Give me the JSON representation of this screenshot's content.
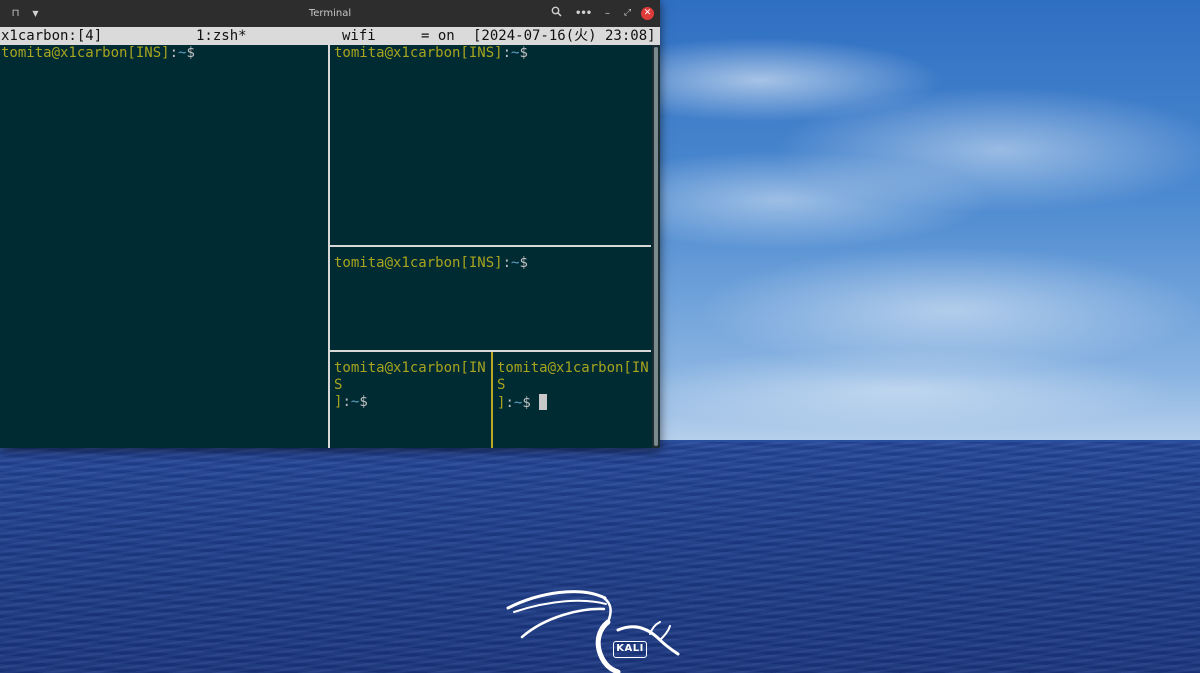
{
  "window": {
    "title": "Terminal"
  },
  "titlebar": {
    "new_tab_icon": "terminal-tab-icon",
    "tab_menu_icon": "chevron-down-icon",
    "search_icon": "search-icon",
    "menu_icon": "more-horizontal-icon",
    "minimize_icon": "minimize-icon",
    "maximize_icon": "maximize-icon",
    "close_icon": "close-icon"
  },
  "tmux_status": {
    "session": "x1carbon:[4]",
    "window": "1:zsh*",
    "wifi_label": "wifi",
    "wifi_state": "= on",
    "datetime": "[2024-07-16(火) 23:08]"
  },
  "panes": [
    {
      "user": "tomita@x1carbon[INS]",
      "sep": ":",
      "path": "~",
      "sign": "$"
    },
    {
      "user": "tomita@x1carbon[INS]",
      "sep": ":",
      "path": "~",
      "sign": "$"
    },
    {
      "user": "tomita@x1carbon[INS]",
      "sep": ":",
      "path": "~",
      "sign": "$"
    },
    {
      "user": "tomita@x1carbon[INS",
      "user_cont": "]",
      "sep": ":",
      "path": "~",
      "sign": "$"
    },
    {
      "user": "tomita@x1carbon[INS",
      "user_cont": "]",
      "sep": ":",
      "path": "~",
      "sign": "$"
    }
  ],
  "desktop": {
    "logo_text": "KALI"
  },
  "colors": {
    "terminal_bg": "#002b33",
    "prompt_user": "#a7a41e",
    "prompt_path": "#5f9fc2",
    "status_bar_bg": "#dadada",
    "active_divider": "#b8a826",
    "close_button": "#e03b3b"
  }
}
